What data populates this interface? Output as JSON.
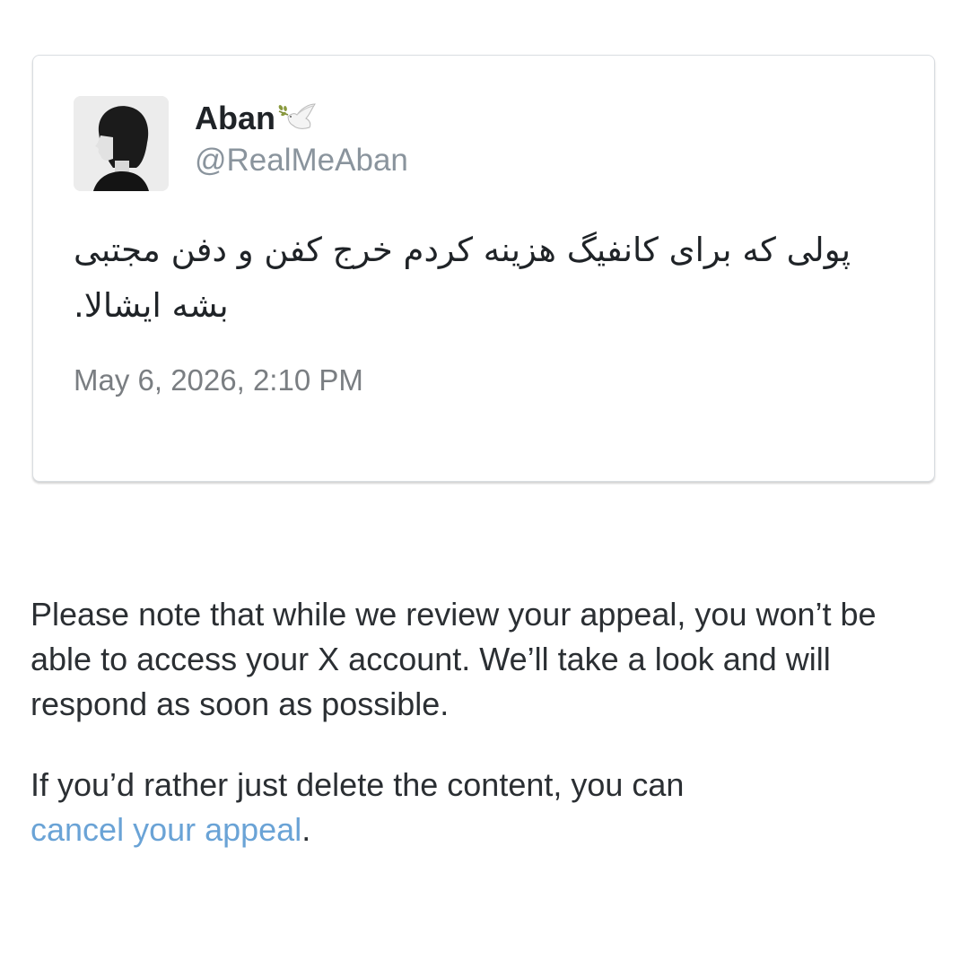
{
  "tweet": {
    "display_name": "Aban",
    "name_emoji_icon": "dove-of-peace-icon",
    "handle": "@RealMeAban",
    "text": "پولی که برای کانفیگ هزینه کردم خرج کفن و دفن مجتبی بشه ایشالا.",
    "timestamp": "May 6, 2026, 2:10 PM"
  },
  "notice": {
    "paragraph1": "Please note that while we review your appeal, you won’t be able to access your X account. We’ll take a look and will respond as soon as possible.",
    "paragraph2_prefix": "If you’d rather just delete the content, you can",
    "cancel_link": "cancel your appeal",
    "paragraph2_suffix": "."
  },
  "colors": {
    "link": "#6aa3d6",
    "handle": "#8a949d",
    "timestamp": "#7a7e82"
  }
}
